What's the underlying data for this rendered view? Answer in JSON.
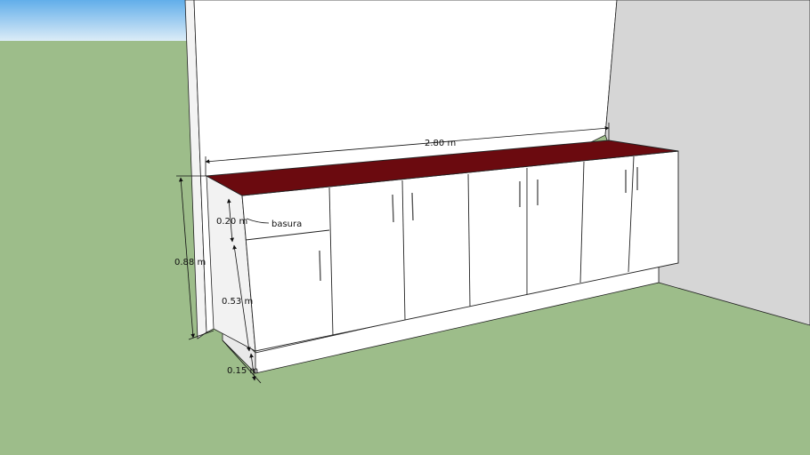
{
  "colors": {
    "sky_top": "#62aeea",
    "sky_bottom": "#dcecf7",
    "ground": "#9dbd8a",
    "countertop": "#6b0a0f",
    "cabinet_front": "#ffffff",
    "cabinet_side": "#f2f2f2",
    "wall_back": "#ffffff",
    "wall_right": "#d6d6d6"
  },
  "dimensions": {
    "total_width": "2.80 m",
    "total_height": "0.88 m",
    "drawer_height": "0.20 m",
    "door_height": "0.53 m",
    "plinth_height": "0.15 m"
  },
  "labels": {
    "drawer_note": "basura"
  }
}
